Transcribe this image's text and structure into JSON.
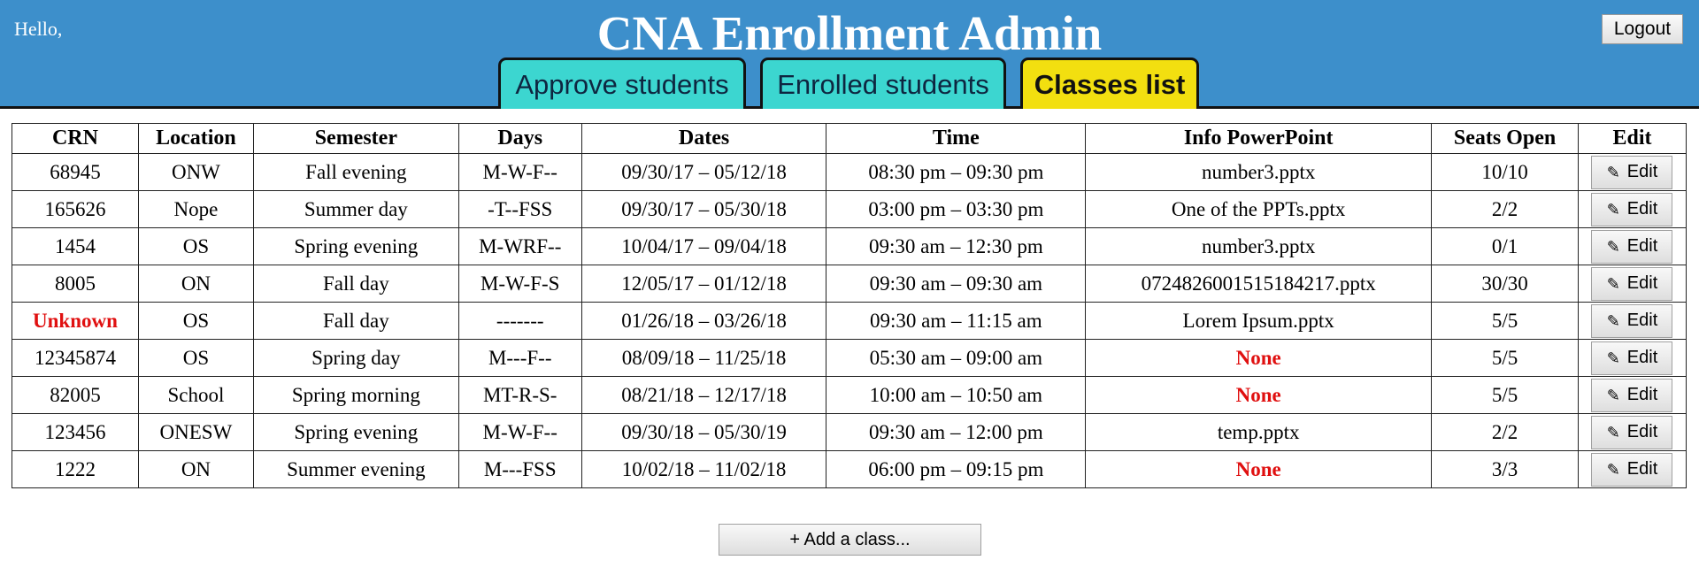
{
  "header": {
    "greeting": "Hello,",
    "title": "CNA Enrollment Admin",
    "logout_label": "Logout",
    "background_color": "#3d8fcb"
  },
  "tabs": [
    {
      "label": "Approve students",
      "active": false,
      "color": "#3cd6d0"
    },
    {
      "label": "Enrolled students",
      "active": false,
      "color": "#3cd6d0"
    },
    {
      "label": "Classes list",
      "active": true,
      "color": "#f2df10"
    }
  ],
  "table": {
    "columns": [
      "CRN",
      "Location",
      "Semester",
      "Days",
      "Dates",
      "Time",
      "Info PowerPoint",
      "Seats Open",
      "Edit"
    ],
    "edit_label": "Edit",
    "edit_icon": "pencil-icon",
    "rows": [
      {
        "crn": "68945",
        "location": "ONW",
        "semester": "Fall evening",
        "days": "M-W-F--",
        "dates": "09/30/17 – 05/12/18",
        "time": "08:30 pm – 09:30 pm",
        "ppt": "number3.pptx",
        "seats": "10/10"
      },
      {
        "crn": "165626",
        "location": "Nope",
        "semester": "Summer day",
        "days": "-T--FSS",
        "dates": "09/30/17 – 05/30/18",
        "time": "03:00 pm – 03:30 pm",
        "ppt": "One of the PPTs.pptx",
        "seats": "2/2"
      },
      {
        "crn": "1454",
        "location": "OS",
        "semester": "Spring evening",
        "days": "M-WRF--",
        "dates": "10/04/17 – 09/04/18",
        "time": "09:30 am – 12:30 pm",
        "ppt": "number3.pptx",
        "seats": "0/1"
      },
      {
        "crn": "8005",
        "location": "ON",
        "semester": "Fall day",
        "days": "M-W-F-S",
        "dates": "12/05/17 – 01/12/18",
        "time": "09:30 am – 09:30 am",
        "ppt": "0724826001515184217.pptx",
        "seats": "30/30"
      },
      {
        "crn": "Unknown",
        "location": "OS",
        "semester": "Fall day",
        "days": "-------",
        "dates": "01/26/18 – 03/26/18",
        "time": "09:30 am – 11:15 am",
        "ppt": "Lorem Ipsum.pptx",
        "seats": "5/5"
      },
      {
        "crn": "12345874",
        "location": "OS",
        "semester": "Spring day",
        "days": "M---F--",
        "dates": "08/09/18 – 11/25/18",
        "time": "05:30 am – 09:00 am",
        "ppt": "None",
        "seats": "5/5"
      },
      {
        "crn": "82005",
        "location": "School",
        "semester": "Spring morning",
        "days": "MT-R-S-",
        "dates": "08/21/18 – 12/17/18",
        "time": "10:00 am – 10:50 am",
        "ppt": "None",
        "seats": "5/5"
      },
      {
        "crn": "123456",
        "location": "ONESW",
        "semester": "Spring evening",
        "days": "M-W-F--",
        "dates": "09/30/18 – 05/30/19",
        "time": "09:30 am – 12:00 pm",
        "ppt": "temp.pptx",
        "seats": "2/2"
      },
      {
        "crn": "1222",
        "location": "ON",
        "semester": "Summer evening",
        "days": "M---FSS",
        "dates": "10/02/18 – 11/02/18",
        "time": "06:00 pm – 09:15 pm",
        "ppt": "None",
        "seats": "3/3"
      }
    ],
    "highlight_color": "#e01010"
  },
  "add_class_label": "+ Add a class..."
}
